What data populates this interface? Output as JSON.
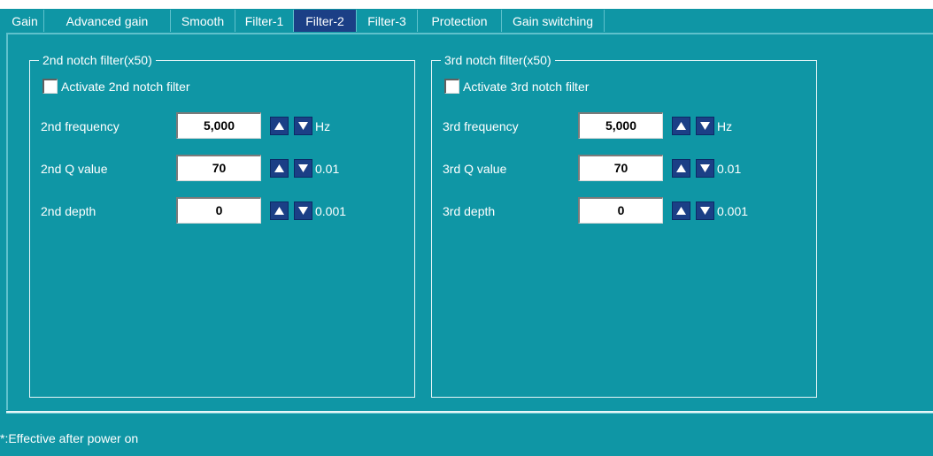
{
  "tabs": [
    {
      "label": "Gain"
    },
    {
      "label": "Advanced gain"
    },
    {
      "label": "Smooth"
    },
    {
      "label": "Filter-1"
    },
    {
      "label": "Filter-2"
    },
    {
      "label": "Filter-3"
    },
    {
      "label": "Protection"
    },
    {
      "label": "Gain switching"
    }
  ],
  "active_tab": "Filter-2",
  "groups": [
    {
      "title": "2nd notch filter(x50)",
      "checkbox_label": "Activate 2nd notch filter",
      "checked": false,
      "params": [
        {
          "label": "2nd frequency",
          "value": "5,000",
          "unit": "Hz"
        },
        {
          "label": "2nd Q value",
          "value": "70",
          "unit": "0.01"
        },
        {
          "label": "2nd depth",
          "value": "0",
          "unit": "0.001"
        }
      ]
    },
    {
      "title": "3rd notch filter(x50)",
      "checkbox_label": "Activate 3rd notch filter",
      "checked": false,
      "params": [
        {
          "label": "3rd frequency",
          "value": "5,000",
          "unit": "Hz"
        },
        {
          "label": "3rd Q value",
          "value": "70",
          "unit": "0.01"
        },
        {
          "label": "3rd depth",
          "value": "0",
          "unit": "0.001"
        }
      ]
    }
  ],
  "status_text": "*:Effective after power on",
  "colors": {
    "background": "#0f96a5",
    "active_tab": "#1b3f86",
    "spin_button": "#1b3f86"
  }
}
